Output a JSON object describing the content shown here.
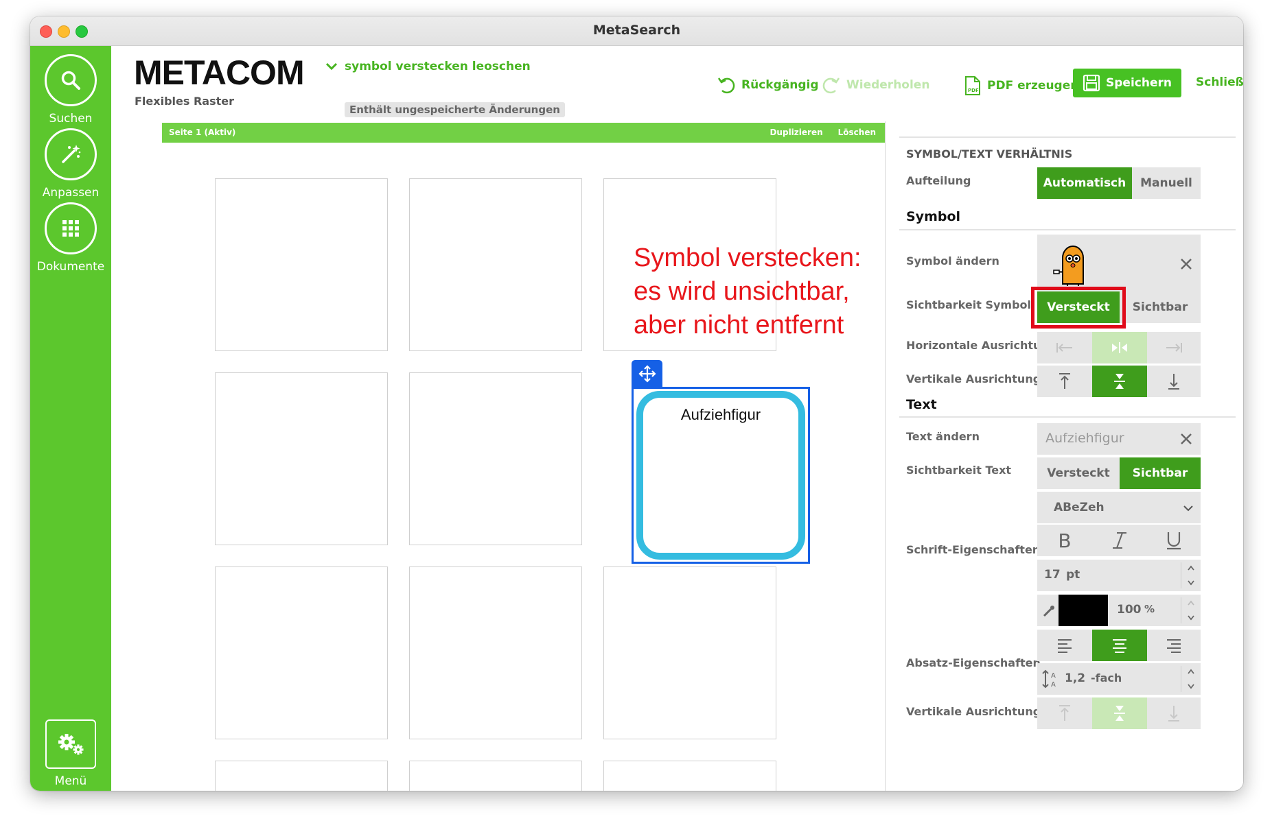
{
  "window": {
    "title": "MetaSearch"
  },
  "sidebar": {
    "items": [
      {
        "label": "Suchen",
        "icon": "search-icon"
      },
      {
        "label": "Anpassen",
        "icon": "magic-wand-icon"
      },
      {
        "label": "Dokumente",
        "icon": "grid-icon"
      }
    ],
    "menu": {
      "label": "Menü",
      "icon": "gears-icon"
    }
  },
  "header": {
    "logo": "METACOM",
    "subtitle": "Flexibles Raster",
    "document_name": "symbol verstecken leoschen",
    "unsaved_notice": "Enthält ungespeicherte Änderungen",
    "undo_label": "Rückgängig",
    "redo_label": "Wiederholen",
    "pdf_label": "PDF erzeugen",
    "save_label": "Speichern",
    "close_label": "Schließen"
  },
  "pagebar": {
    "title": "Seite 1 (Aktiv)",
    "duplicate_label": "Duplizieren",
    "delete_label": "Löschen"
  },
  "annotation": {
    "lines": [
      "Symbol verstecken:",
      "es wird unsichtbar,",
      "aber nicht entfernt"
    ]
  },
  "selected_card": {
    "text": "Aufziehfigur"
  },
  "panel": {
    "ratio_heading": "SYMBOL/TEXT VERHÄLTNIS",
    "split_label": "Aufteilung",
    "split_options": [
      "Automatisch",
      "Manuell"
    ],
    "split_selected": "Automatisch",
    "symbol_heading": "Symbol",
    "symbol_change_label": "Symbol ändern",
    "symbol_visibility_label": "Sichtbarkeit Symbol",
    "symbol_visibility_options": [
      "Versteckt",
      "Sichtbar"
    ],
    "symbol_visibility_selected": "Versteckt",
    "symbol_halign_label": "Horizontale Ausrichtung",
    "symbol_valign_label": "Vertikale Ausrichtung",
    "text_heading": "Text",
    "text_change_label": "Text ändern",
    "text_value": "Aufziehfigur",
    "text_visibility_label": "Sichtbarkeit Text",
    "text_visibility_options": [
      "Versteckt",
      "Sichtbar"
    ],
    "text_visibility_selected": "Sichtbar",
    "font_name": "ABeZeh",
    "font_props_label": "Schrift-Eigenschaften",
    "font_size": "17",
    "font_size_unit": "pt",
    "opacity": "100",
    "opacity_unit": "%",
    "text_color": "#000000",
    "paragraph_props_label": "Absatz-Eigenschaften",
    "line_spacing": "1,2",
    "line_spacing_unit": "-fach",
    "text_valign_label": "Vertikale Ausrichtung"
  },
  "colors": {
    "brand_green": "#5cc72d",
    "selected_green": "#3f9d1c",
    "highlight_red": "#e00b1a",
    "selection_blue": "#1560e6",
    "card_border": "#34bce0"
  }
}
